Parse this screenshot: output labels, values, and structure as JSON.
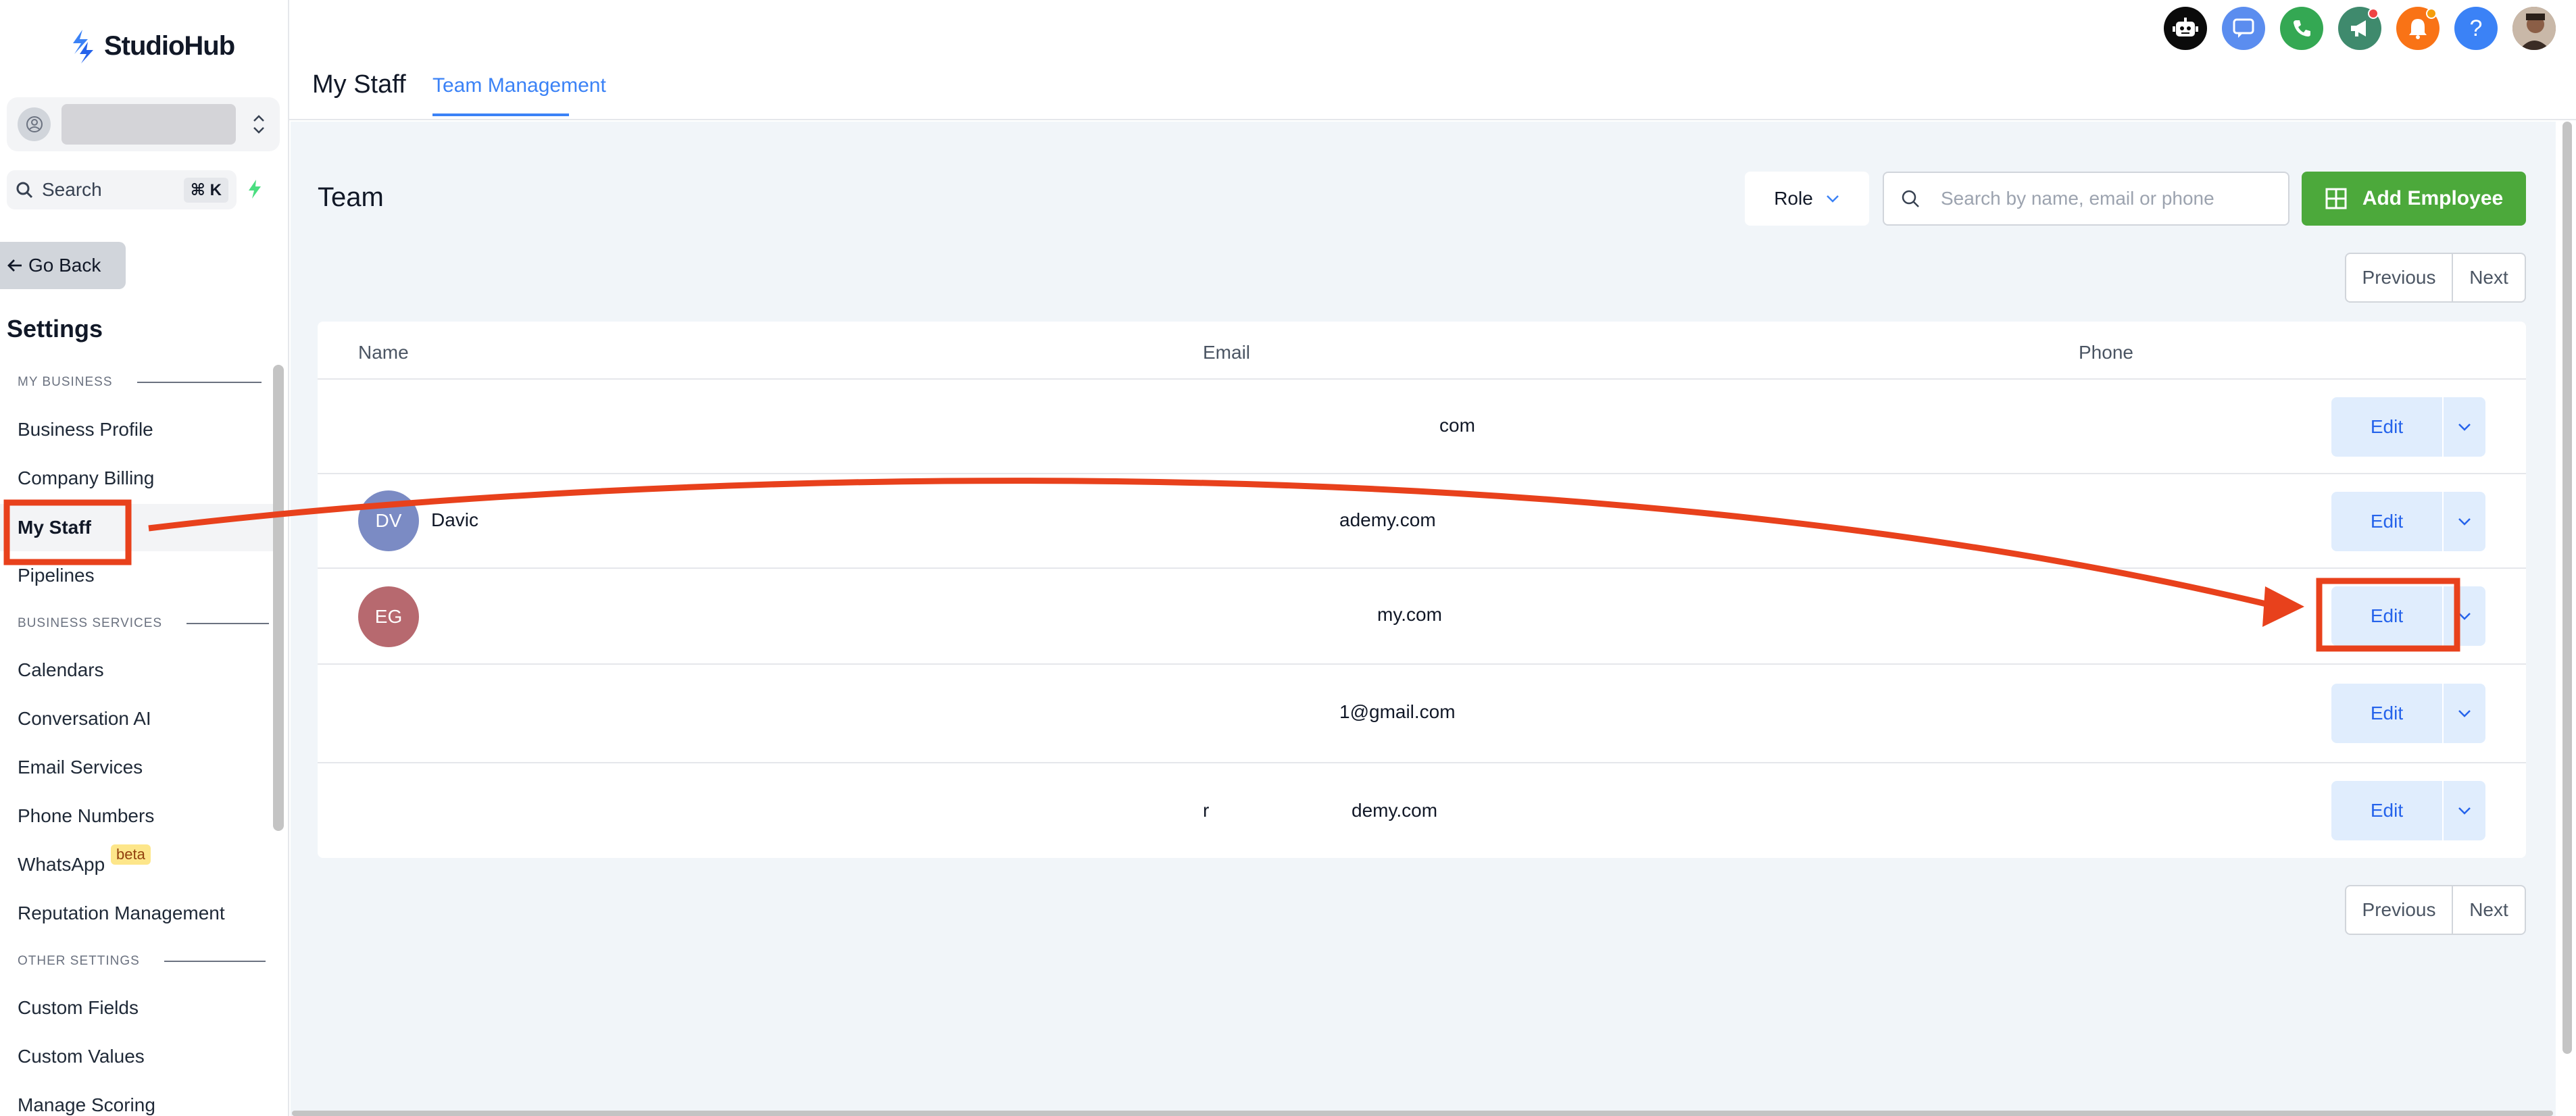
{
  "brand": {
    "name": "StudioHub"
  },
  "sidebar": {
    "search_label": "Search",
    "search_shortcut": "⌘ K",
    "go_back": "Go Back",
    "settings_title": "Settings",
    "sections": {
      "my_business": "MY BUSINESS",
      "business_services": "BUSINESS SERVICES",
      "other_settings": "OTHER SETTINGS"
    },
    "items": {
      "business_profile": "Business Profile",
      "company_billing": "Company Billing",
      "my_staff": "My Staff",
      "pipelines": "Pipelines",
      "calendars": "Calendars",
      "conversation_ai": "Conversation AI",
      "email_services": "Email Services",
      "phone_numbers": "Phone Numbers",
      "whatsapp": "WhatsApp",
      "whatsapp_badge": "beta",
      "reputation_management": "Reputation Management",
      "custom_fields": "Custom Fields",
      "custom_values": "Custom Values",
      "manage_scoring": "Manage Scoring"
    },
    "active_item": "my_staff"
  },
  "header": {
    "page_title": "My Staff",
    "tabs": [
      {
        "label": "Team Management",
        "active": true
      }
    ],
    "icons": [
      "bot-icon",
      "chat-icon",
      "phone-icon",
      "megaphone-icon",
      "bell-icon",
      "help-icon",
      "user-avatar"
    ],
    "help_glyph": "?"
  },
  "main": {
    "title": "Team",
    "role_filter": "Role",
    "search_placeholder": "Search by name, email or phone",
    "add_button": "Add Employee",
    "pagination": {
      "previous": "Previous",
      "next": "Next"
    },
    "table": {
      "columns": [
        "Name",
        "Email",
        "Phone"
      ],
      "rows": [
        {
          "initials": "",
          "name": "",
          "email": "com",
          "phone": "",
          "action": "Edit"
        },
        {
          "initials": "DV",
          "name": "Davic",
          "email": "ademy.com",
          "phone": "",
          "action": "Edit"
        },
        {
          "initials": "EG",
          "name": "",
          "email": "my.com",
          "phone": "",
          "action": "Edit"
        },
        {
          "initials": "",
          "name": "",
          "email": "1@gmail.com",
          "phone": "",
          "action": "Edit"
        },
        {
          "initials": "",
          "name": "",
          "email": "demy.com",
          "email_prefix": "r",
          "phone": "",
          "action": "Edit"
        }
      ]
    }
  },
  "colors": {
    "accent_blue": "#3b82f6",
    "add_green": "#4ca93b",
    "annotation_red": "#e8411c",
    "avatar_dv": "#7b8bc4",
    "avatar_eg": "#b7696f"
  }
}
